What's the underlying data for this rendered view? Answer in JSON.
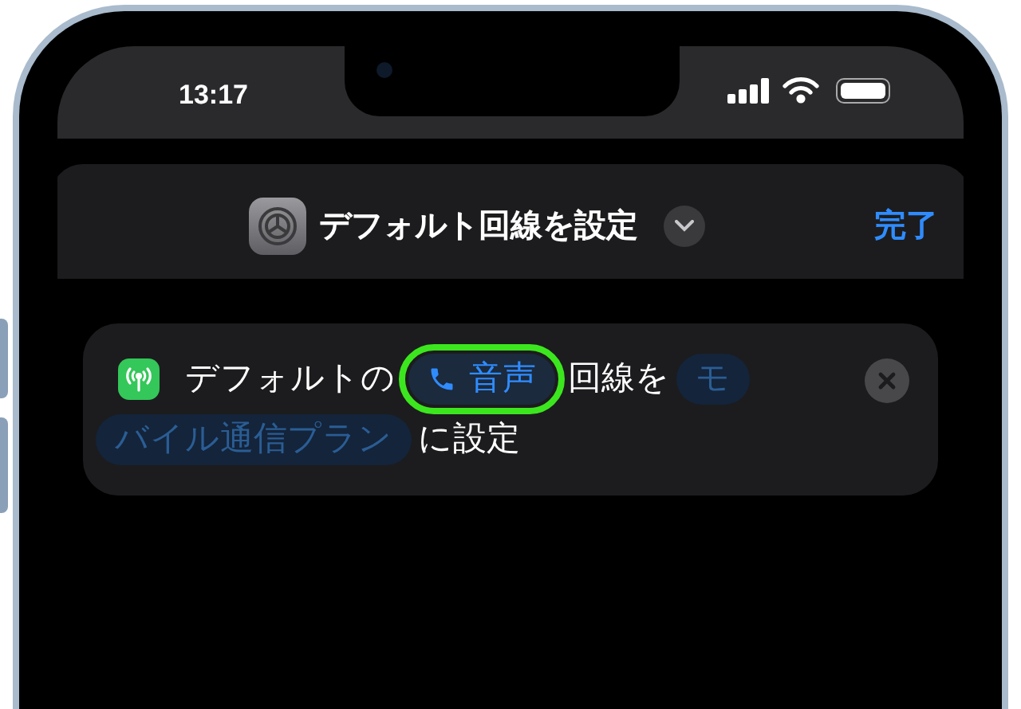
{
  "status_bar": {
    "time": "13:17"
  },
  "header": {
    "title": "デフォルト回線を設定",
    "done": "完了"
  },
  "action": {
    "lines": [
      [
        {
          "kind": "app-icon"
        },
        {
          "kind": "text",
          "text": "デフォルトの"
        },
        {
          "kind": "phone-token",
          "text": "音声",
          "dimmed": false,
          "highlighted": true
        },
        {
          "kind": "text",
          "text": "回線を"
        },
        {
          "kind": "token",
          "text": "モ",
          "dimmed": true,
          "highlighted": false
        }
      ],
      [
        {
          "kind": "token",
          "text": "バイル通信プラン",
          "dimmed": true,
          "highlighted": false
        },
        {
          "kind": "text",
          "text": "に設定"
        }
      ]
    ]
  }
}
